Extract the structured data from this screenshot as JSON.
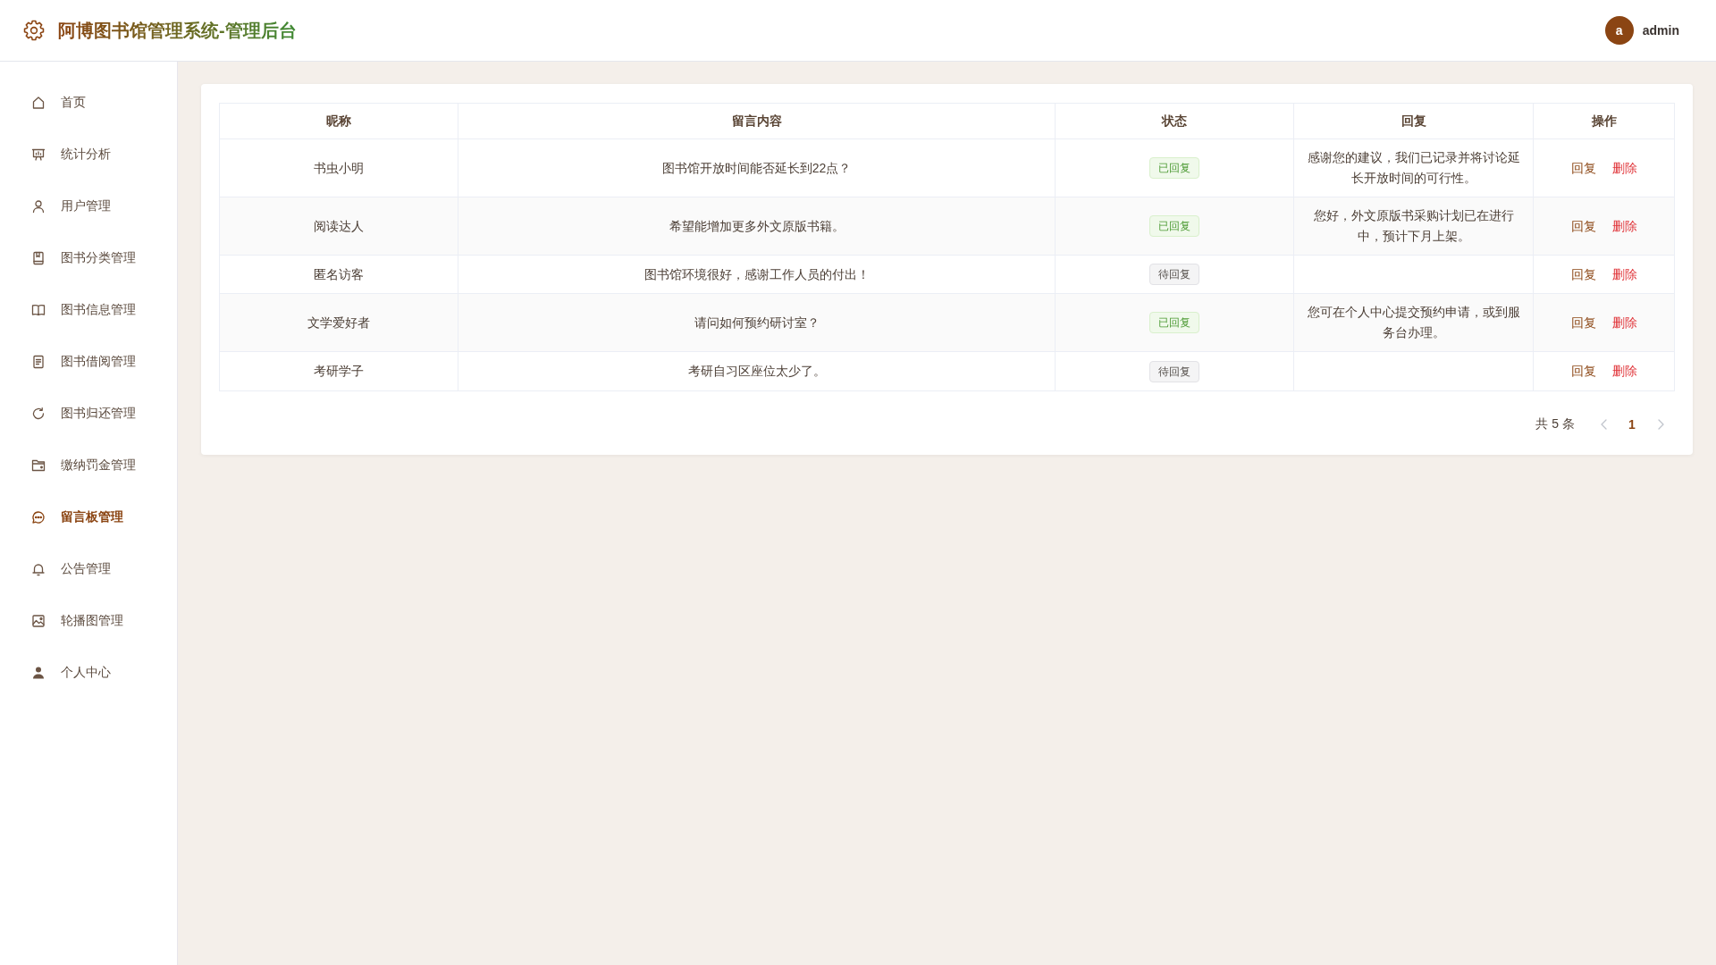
{
  "header": {
    "title": "阿博图书馆管理系统-管理后台",
    "user": {
      "avatar": "a",
      "name": "admin"
    }
  },
  "sidebar": {
    "items": [
      {
        "label": "首页",
        "selected": false
      },
      {
        "label": "统计分析",
        "selected": false
      },
      {
        "label": "用户管理",
        "selected": false
      },
      {
        "label": "图书分类管理",
        "selected": false
      },
      {
        "label": "图书信息管理",
        "selected": false
      },
      {
        "label": "图书借阅管理",
        "selected": false
      },
      {
        "label": "图书归还管理",
        "selected": false
      },
      {
        "label": "缴纳罚金管理",
        "selected": false
      },
      {
        "label": "留言板管理",
        "selected": true
      },
      {
        "label": "公告管理",
        "selected": false
      },
      {
        "label": "轮播图管理",
        "selected": false
      },
      {
        "label": "个人中心",
        "selected": false
      }
    ]
  },
  "table": {
    "columns": [
      "昵称",
      "留言内容",
      "状态",
      "回复",
      "操作"
    ],
    "rows": [
      {
        "nickname": "书虫小明",
        "message": "图书馆开放时间能否延长到22点？",
        "status": {
          "label": "已回复",
          "replied": true
        },
        "reply": "感谢您的建议，我们已记录并将讨论延长开放时间的可行性。",
        "actions": [
          {
            "label": "回复",
            "kind": "reply"
          },
          {
            "label": "删除",
            "kind": "delete"
          }
        ]
      },
      {
        "nickname": "阅读达人",
        "message": "希望能增加更多外文原版书籍。",
        "status": {
          "label": "已回复",
          "replied": true
        },
        "reply": "您好，外文原版书采购计划已在进行中，预计下月上架。",
        "actions": [
          {
            "label": "回复",
            "kind": "reply"
          },
          {
            "label": "删除",
            "kind": "delete"
          }
        ]
      },
      {
        "nickname": "匿名访客",
        "message": "图书馆环境很好，感谢工作人员的付出！",
        "status": {
          "label": "待回复",
          "replied": false
        },
        "actions": [
          {
            "label": "回复",
            "kind": "reply"
          },
          {
            "label": "删除",
            "kind": "delete"
          }
        ]
      },
      {
        "nickname": "文学爱好者",
        "message": "请问如何预约研讨室？",
        "status": {
          "label": "已回复",
          "replied": true
        },
        "reply": "您可在个人中心提交预约申请，或到服务台办理。",
        "actions": [
          {
            "label": "回复",
            "kind": "reply"
          },
          {
            "label": "删除",
            "kind": "delete"
          }
        ]
      },
      {
        "nickname": "考研学子",
        "message": "考研自习区座位太少了。",
        "status": {
          "label": "待回复",
          "replied": false
        },
        "actions": [
          {
            "label": "回复",
            "kind": "reply"
          },
          {
            "label": "删除",
            "kind": "delete"
          }
        ]
      }
    ]
  },
  "pagination": {
    "total": "共 5 条",
    "prev": {
      "disabled": true
    },
    "pages": [
      {
        "label": "1",
        "selected": true
      }
    ],
    "next": {
      "disabled": true
    }
  }
}
